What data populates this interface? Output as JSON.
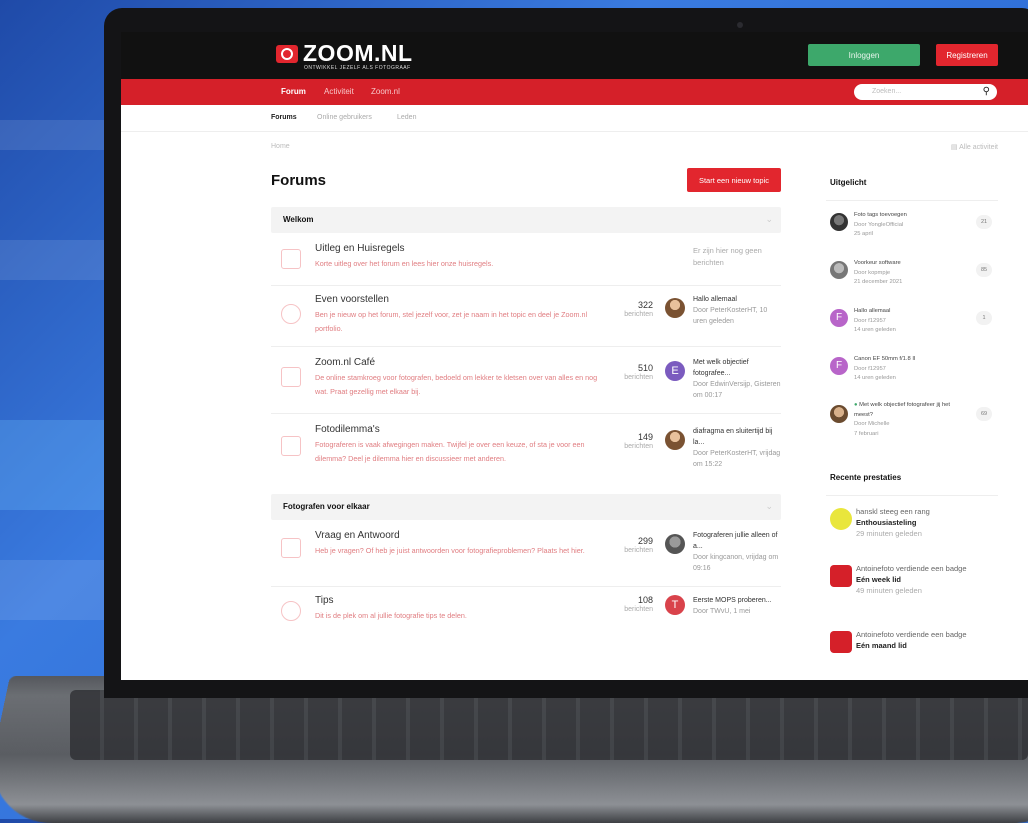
{
  "header": {
    "logo": "ZOOM.NL",
    "tagline": "ONTWIKKEL JEZELF ALS FOTOGRAAF",
    "login": "Inloggen",
    "register": "Registreren"
  },
  "nav": {
    "items": [
      "Forum",
      "Activiteit",
      "Zoom.nl"
    ],
    "search_placeholder": "Zoeken..."
  },
  "subnav": {
    "items": [
      "Forums",
      "Online gebruikers",
      "Leden"
    ]
  },
  "breadcrumb": "Home",
  "recent_activity": "Alle activiteit",
  "main": {
    "title": "Forums",
    "new_topic": "Start een nieuw topic",
    "categories": [
      {
        "title": "Welkom",
        "forums": [
          {
            "title": "Uitleg en Huisregels",
            "desc": "Korte uitleg over het forum en lees hier onze huisregels.",
            "empty": "Er zijn hier nog geen berichten"
          },
          {
            "title": "Even voorstellen",
            "desc": "Ben je nieuw op het forum, stel jezelf voor, zet je naam in het topic en deel je Zoom.nl portfolio.",
            "count": "322",
            "count_label": "berichten",
            "last_title": "Hallo allemaal",
            "last_meta": "Door PeterKosterHT, 10 uren geleden"
          },
          {
            "title": "Zoom.nl Café",
            "desc": "De online stamkroeg voor fotografen, bedoeld om lekker te kletsen over van alles en nog wat. Praat gezellig met elkaar bij.",
            "count": "510",
            "count_label": "berichten",
            "avatar_letter": "E",
            "last_title": "Met welk objectief fotografee...",
            "last_meta": "Door EdwinVersijp, Gisteren om 00:17"
          },
          {
            "title": "Fotodilemma's",
            "desc": "Fotograferen is vaak afwegingen maken. Twijfel je over een keuze, of sta je voor een dilemma? Deel je dilemma hier en discussieer met anderen.",
            "count": "149",
            "count_label": "berichten",
            "last_title": "diafragma en sluitertijd bij la...",
            "last_meta": "Door PeterKosterHT, vrijdag om 15:22"
          }
        ]
      },
      {
        "title": "Fotografen voor elkaar",
        "forums": [
          {
            "title": "Vraag en Antwoord",
            "desc": "Heb je vragen? Of heb je juist antwoorden voor fotografieproblemen? Plaats het hier.",
            "count": "299",
            "count_label": "berichten",
            "last_title": "Fotograferen jullie alleen of a...",
            "last_meta": "Door kingcanon, vrijdag om 09:16"
          },
          {
            "title": "Tips",
            "desc": "Dit is de plek om al jullie fotografie tips te delen.",
            "count": "108",
            "count_label": "berichten",
            "avatar_letter": "T",
            "last_title": "Eerste MOPS proberen...",
            "last_meta": "Door TWvU, 1 mei"
          }
        ]
      }
    ]
  },
  "sidebar": {
    "featured_title": "Uitgelicht",
    "featured": [
      {
        "title": "Foto tags toevoegen",
        "by": "Door YongleOfficial",
        "when": "25 april",
        "count": "21"
      },
      {
        "title": "Voorkeur software",
        "by": "Door kopmpje",
        "when": "21 december 2021",
        "count": "85"
      },
      {
        "title": "Hallo allemaal",
        "by": "Door f12957",
        "when": "14 uren geleden",
        "count": "1",
        "letter": "F"
      },
      {
        "title": "Canon EF 50mm f/1.8 II",
        "by": "Door f12957",
        "when": "14 uren geleden",
        "count": "",
        "letter": "F"
      },
      {
        "title": "Met welk objectief fotografeer jij het meest?",
        "by": "Door Michelle",
        "when": "7 februari",
        "count": "69"
      }
    ],
    "achievements_title": "Recente prestaties",
    "achievements": [
      {
        "line1": "hanskl steeg een rang",
        "bold": "Enthousiasteling",
        "time": "29 minuten geleden"
      },
      {
        "line1": "Antoinefoto verdiende een badge",
        "bold": "Eén week lid",
        "time": "49 minuten geleden"
      },
      {
        "line1": "Antoinefoto verdiende een badge",
        "bold": "Eén maand lid",
        "time": ""
      }
    ]
  },
  "colors": {
    "brand": "#e2262e",
    "login": "#3da86b"
  }
}
